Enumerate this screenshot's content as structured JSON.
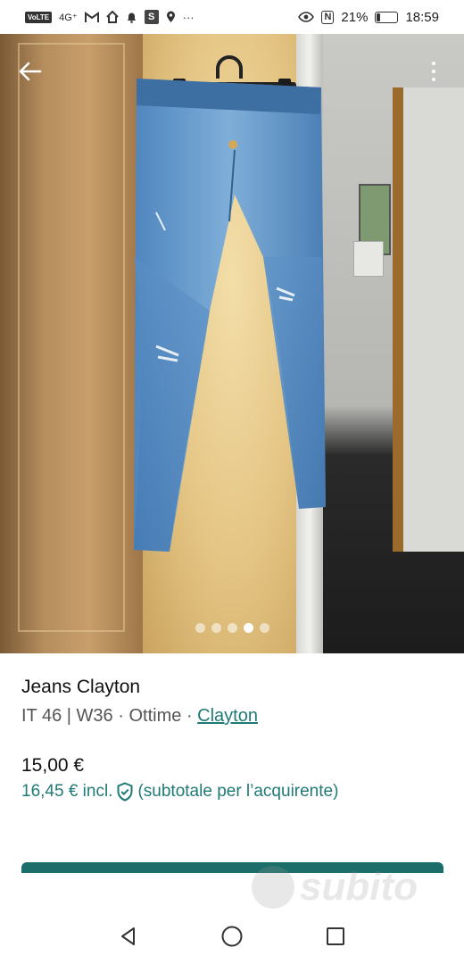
{
  "status_bar": {
    "volte": "VoLTE",
    "signal": "4G⁺",
    "battery_text": "21%",
    "battery_level": 0.21,
    "time": "18:59",
    "nfc_glyph": "N",
    "more_glyph": "···",
    "s_glyph": "S"
  },
  "gallery": {
    "image_count": 5,
    "active_index": 3
  },
  "listing": {
    "title": "Jeans Clayton",
    "size_it": "IT 46",
    "size_w": "W36",
    "condition": "Ottime",
    "brand": "Clayton",
    "separator_bar": "|",
    "separator_dot": "·",
    "price": "15,00 €",
    "price_incl": "16,45 € incl.",
    "price_incl_note": "(subtotale per l’acquirente)"
  },
  "watermark": {
    "text": "subito"
  },
  "colors": {
    "accent": "#1f7a76",
    "cta": "#1b6e6a"
  },
  "icons": {
    "back": "back-arrow-icon",
    "more": "more-vertical-icon",
    "shield": "shield-check-icon",
    "nav_back": "triangle-back-icon",
    "nav_home": "circle-home-icon",
    "nav_recent": "square-recents-icon"
  }
}
